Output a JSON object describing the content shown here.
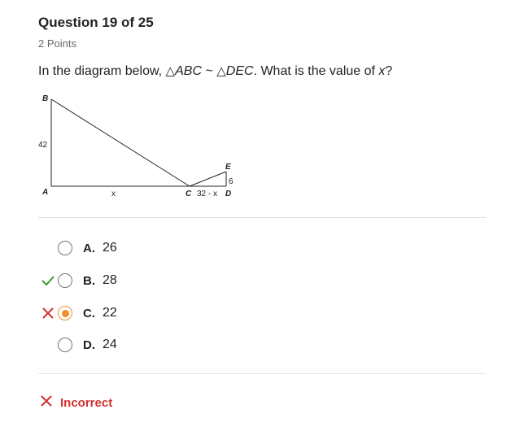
{
  "question": {
    "title": "Question 19 of 25",
    "points": "2 Points",
    "text_prefix": "In the diagram below, ",
    "tri1": "ABC",
    "similar": " ~ ",
    "tri2": "DEC",
    "text_middle": ". What is the value of ",
    "variable": "x",
    "text_suffix": "?"
  },
  "diagram": {
    "labels": {
      "B": "B",
      "A": "A",
      "C": "C",
      "D": "D",
      "E": "E",
      "side_ab": "42",
      "side_ac": "x",
      "side_cd": "32 - x",
      "side_de": "6"
    }
  },
  "options": [
    {
      "letter": "A.",
      "value": "26",
      "selected": false,
      "status": "none"
    },
    {
      "letter": "B.",
      "value": "28",
      "selected": false,
      "status": "correct"
    },
    {
      "letter": "C.",
      "value": "22",
      "selected": true,
      "status": "incorrect"
    },
    {
      "letter": "D.",
      "value": "24",
      "selected": false,
      "status": "none"
    }
  ],
  "result": {
    "label": "Incorrect",
    "status": "incorrect"
  },
  "colors": {
    "correct": "#3a9a3a",
    "incorrect": "#d32f2f",
    "selected": "#f0902c"
  },
  "icons": {
    "correct": "check-icon",
    "incorrect": "x-icon"
  }
}
